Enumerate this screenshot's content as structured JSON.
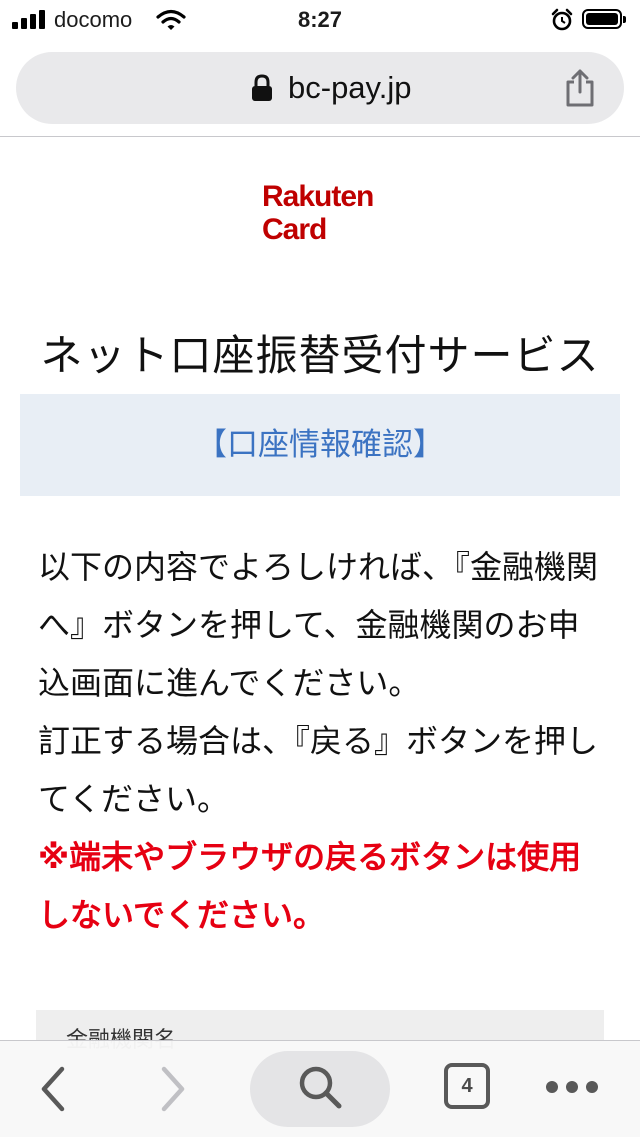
{
  "status_bar": {
    "carrier": "docomo",
    "time": "8:27",
    "icons": [
      "signal-icon",
      "wifi-icon",
      "alarm-icon",
      "battery-icon"
    ]
  },
  "browser": {
    "url": "bc-pay.jp",
    "icons": [
      "lock-icon",
      "share-icon"
    ]
  },
  "logo": {
    "line1": "Rakuten",
    "line2": "Card",
    "color": "#bf0000"
  },
  "page": {
    "title": "ネット口座振替受付サービス",
    "section_heading": "【口座情報確認】",
    "instructions": "以下の内容でよろしければ、『金融機関へ』ボタンを押して、金融機関のお申込画面に進んでください。",
    "correction": "訂正する場合は、『戻る』ボタンを押してください。",
    "warning": "※端末やブラウザの戻るボタンは使用しないでください。",
    "info_label": "金融機関名"
  },
  "toolbar": {
    "tab_count": "4",
    "icons": [
      "back-icon",
      "forward-icon",
      "search-icon",
      "tabs-icon",
      "more-icon"
    ]
  },
  "colors": {
    "accent_blue": "#3b73c2",
    "warning_red": "#e60012",
    "banner_bg": "#e8eef5"
  }
}
